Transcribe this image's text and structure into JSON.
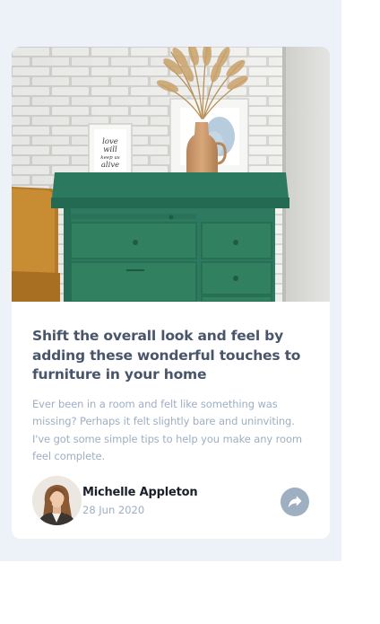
{
  "article": {
    "title": "Shift the overall look and feel by adding these wonderful touches to furniture in your home",
    "description": "Ever been in a room and felt like something was missing? Perhaps it felt slightly bare and uninviting. I've got some simple tips to help you make any room feel complete.",
    "image_text": [
      "love",
      "will",
      "keep us",
      "alive"
    ]
  },
  "author": {
    "name": "Michelle Appleton",
    "date": "28 Jun 2020"
  },
  "icons": {
    "share": "share-icon"
  },
  "colors": {
    "page_background": "#ecf2f8",
    "card_background": "#ffffff",
    "title": "#48556a",
    "muted": "#9eafc2",
    "author_name": "#1b1f29",
    "share_button": "#9eafc2",
    "drawers_green": "#2e7a60"
  }
}
